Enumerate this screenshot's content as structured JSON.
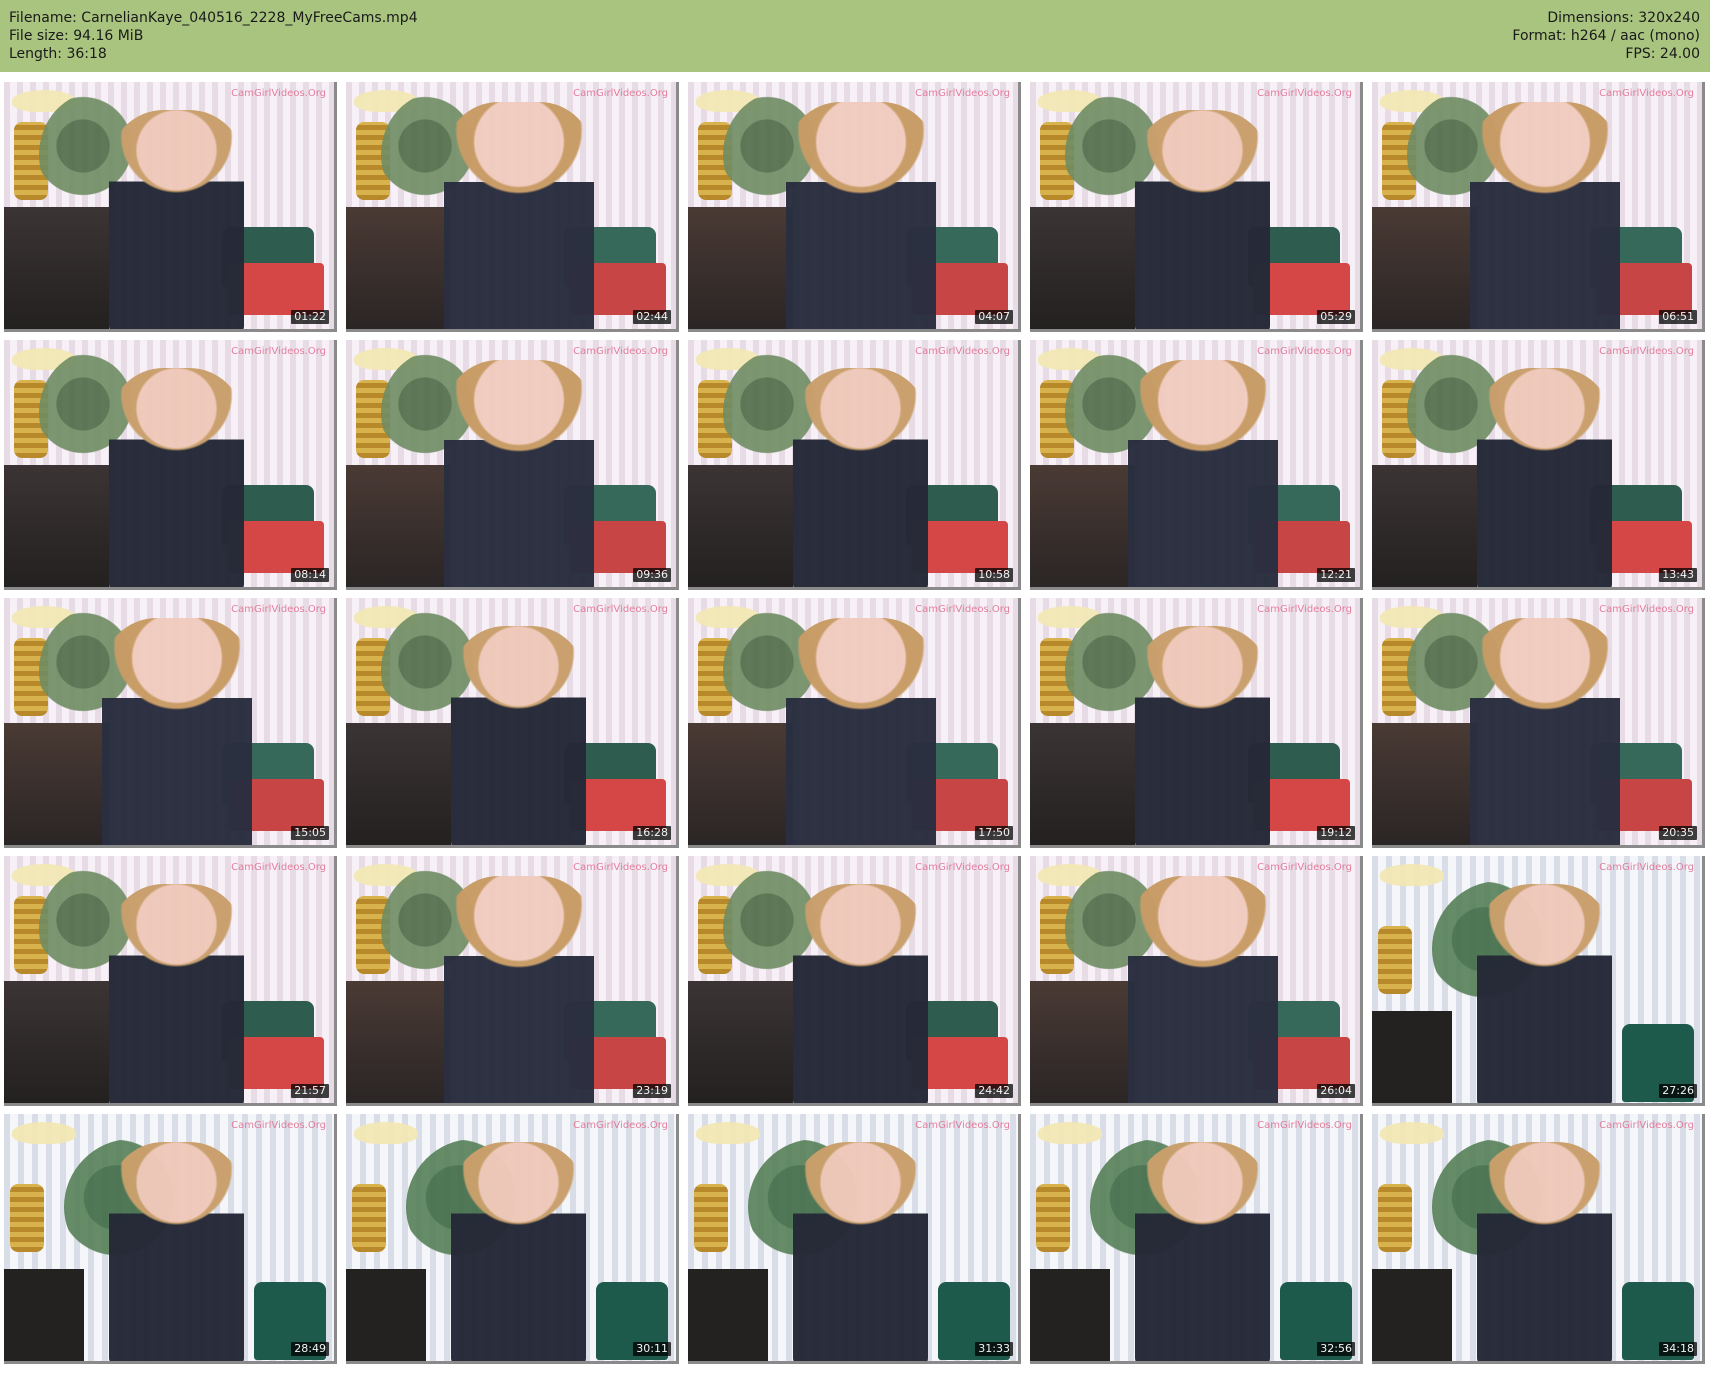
{
  "header": {
    "filename_label": "Filename: CarnelianKaye_040516_2228_MyFreeCams.mp4",
    "filesize_label": "File size: 94.16 MiB",
    "length_label": "Length: 36:18",
    "dimensions_label": "Dimensions: 320x240",
    "format_label": "Format: h264 / aac (mono)",
    "fps_label": "FPS: 24.00"
  },
  "thumbnail_watermark": "CamGirlVideos.Org",
  "thumbnails": [
    {
      "time": "01:22"
    },
    {
      "time": "02:44"
    },
    {
      "time": "04:07"
    },
    {
      "time": "05:29"
    },
    {
      "time": "06:51"
    },
    {
      "time": "08:14"
    },
    {
      "time": "09:36"
    },
    {
      "time": "10:58"
    },
    {
      "time": "12:21"
    },
    {
      "time": "13:43"
    },
    {
      "time": "15:05"
    },
    {
      "time": "16:28"
    },
    {
      "time": "17:50"
    },
    {
      "time": "19:12"
    },
    {
      "time": "20:35"
    },
    {
      "time": "21:57"
    },
    {
      "time": "23:19"
    },
    {
      "time": "24:42"
    },
    {
      "time": "26:04"
    },
    {
      "time": "27:26"
    },
    {
      "time": "28:49"
    },
    {
      "time": "30:11"
    },
    {
      "time": "31:33"
    },
    {
      "time": "32:56"
    },
    {
      "time": "34:18"
    }
  ],
  "colors": {
    "header_bg": "#a9c47f",
    "page_bg": "#ffffff",
    "timestamp_bg": "#000000",
    "timestamp_text": "#f3f3f3",
    "watermark_text": "#e26b8d"
  }
}
